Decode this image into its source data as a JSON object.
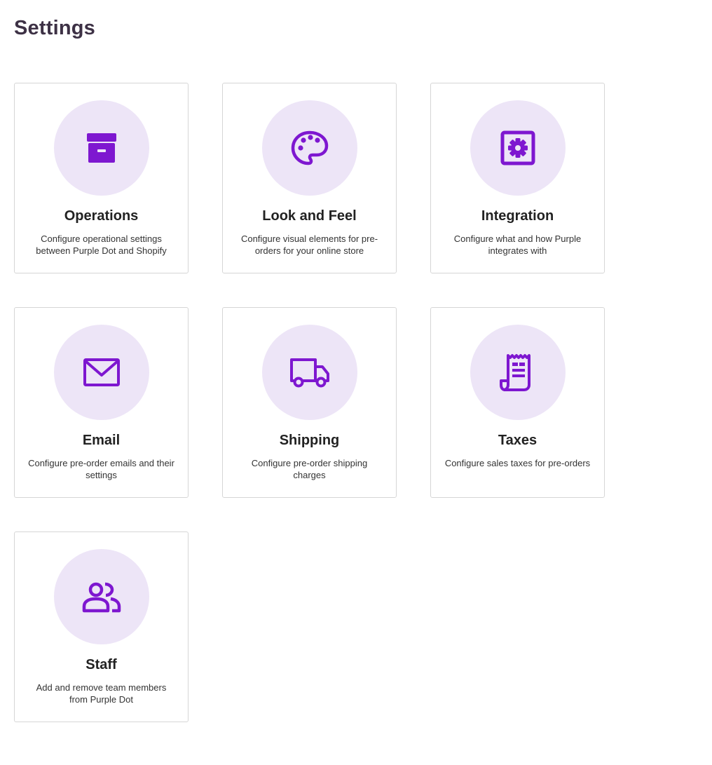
{
  "page": {
    "title": "Settings"
  },
  "colors": {
    "accent": "#7e17d0",
    "icon_bg": "#ede5f7",
    "title_text": "#3d3145"
  },
  "cards": [
    {
      "title": "Operations",
      "description": "Configure operational settings between Purple Dot and Shopify",
      "icon": "archive-box-icon"
    },
    {
      "title": "Look and Feel",
      "description": "Configure visual elements for pre-orders for your online store",
      "icon": "palette-icon"
    },
    {
      "title": "Integration",
      "description": "Configure what and how Purple integrates with",
      "icon": "gear-square-icon"
    },
    {
      "title": "Email",
      "description": "Configure pre-order emails and their settings",
      "icon": "envelope-icon"
    },
    {
      "title": "Shipping",
      "description": "Configure pre-order shipping charges",
      "icon": "truck-icon"
    },
    {
      "title": "Taxes",
      "description": "Configure sales taxes for pre-orders",
      "icon": "receipt-icon"
    },
    {
      "title": "Staff",
      "description": "Add and remove team members from Purple Dot",
      "icon": "users-icon"
    }
  ]
}
